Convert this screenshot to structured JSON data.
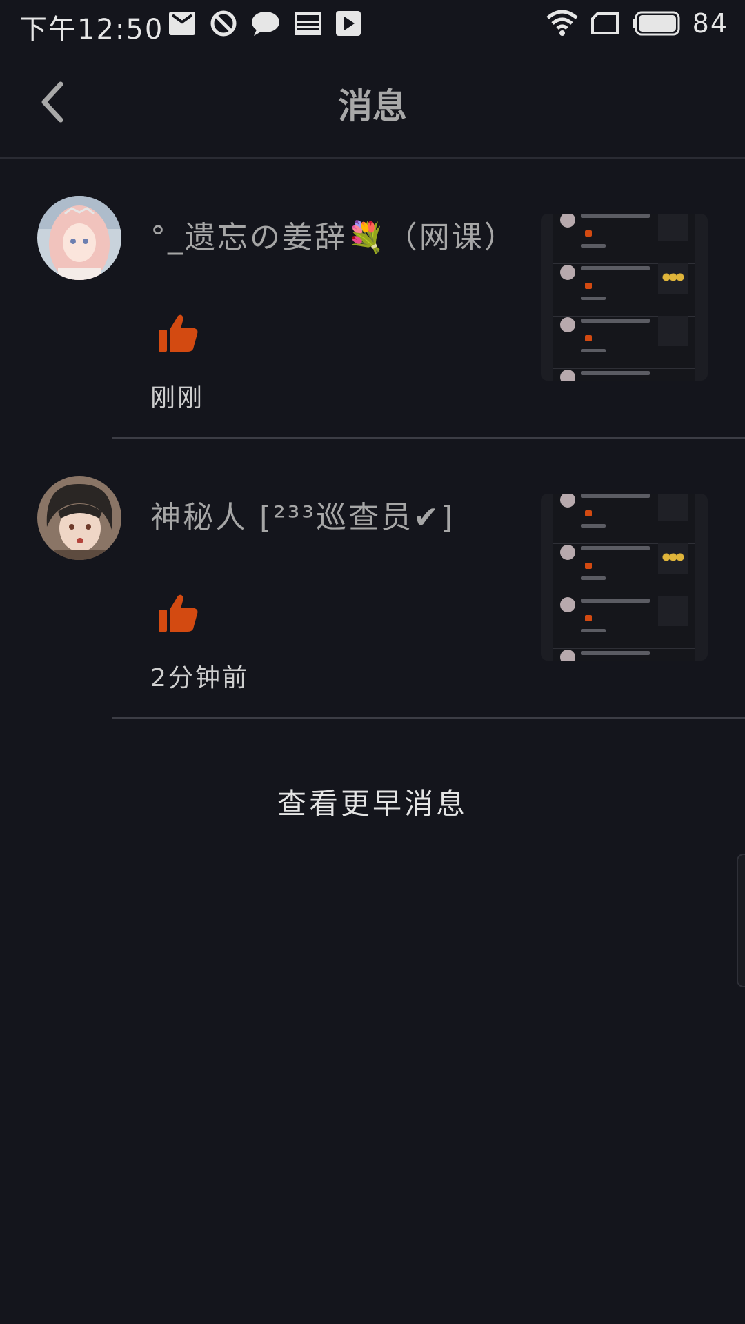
{
  "status_bar": {
    "time": "下午12:50",
    "battery": "84",
    "icons_left": [
      "mail-icon",
      "block-icon",
      "chat-bubble-icon",
      "news-icon",
      "play-store-icon"
    ],
    "icons_right": [
      "wifi-icon",
      "sim-icon",
      "battery-icon"
    ]
  },
  "header": {
    "title": "消息",
    "back_icon": "chevron-left-icon"
  },
  "messages": [
    {
      "username": "°_遗忘の姜辞💐（网课）",
      "action_icon": "thumbs-up-icon",
      "time": "刚刚"
    },
    {
      "username": "神秘人 [²³³巡查员✔]",
      "action_icon": "thumbs-up-icon",
      "time": "2分钟前"
    }
  ],
  "load_earlier": "查看更早消息",
  "colors": {
    "background": "#14151c",
    "like": "#d34a11",
    "divider": "#3c3d45"
  }
}
